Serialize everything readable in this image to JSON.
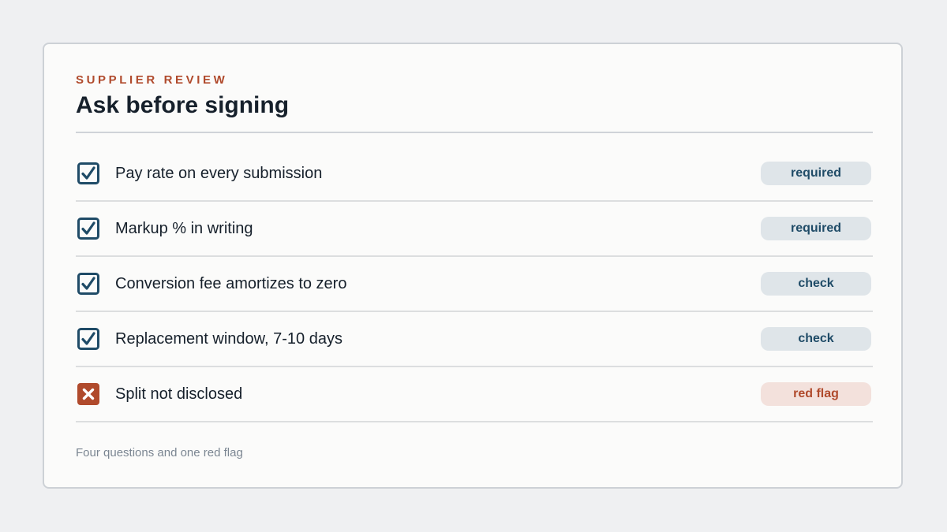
{
  "header": {
    "eyebrow": "SUPPLIER REVIEW",
    "title": "Ask before signing"
  },
  "items": [
    {
      "label": "Pay rate on every submission",
      "status": "checked",
      "badge": "required",
      "badge_kind": "neutral",
      "icon": "checkbox-checked-icon"
    },
    {
      "label": "Markup % in writing",
      "status": "checked",
      "badge": "required",
      "badge_kind": "neutral",
      "icon": "checkbox-checked-icon"
    },
    {
      "label": "Conversion fee amortizes to zero",
      "status": "checked",
      "badge": "check",
      "badge_kind": "neutral",
      "icon": "checkbox-checked-icon"
    },
    {
      "label": "Replacement window, 7-10 days",
      "status": "checked",
      "badge": "check",
      "badge_kind": "neutral",
      "icon": "checkbox-checked-icon"
    },
    {
      "label": "Split not disclosed",
      "status": "flagged",
      "badge": "red flag",
      "badge_kind": "flag",
      "icon": "x-box-icon"
    }
  ],
  "footer": {
    "note": "Four questions and one red flag"
  },
  "colors": {
    "accent": "#b04a2c",
    "check": "#1f4b67",
    "flag": "#b04a2c",
    "text": "#16202b",
    "muted": "#7b8692"
  }
}
